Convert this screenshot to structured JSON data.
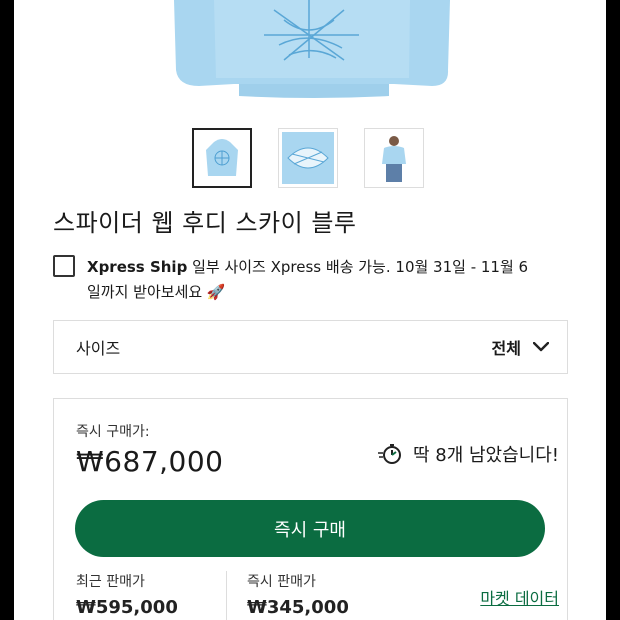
{
  "product": {
    "title": "스파이더 웹 후디 스카이 블루"
  },
  "xpress": {
    "brand": "Xpress Ship",
    "message_line1": "일부 사이즈 Xpress 배송 가능. 10월 31일 - 11월 6",
    "message_line2": "일까지 받아보세요 🚀"
  },
  "size_selector": {
    "label": "사이즈",
    "value": "전체"
  },
  "buy": {
    "label": "즉시 구매가:",
    "price": "₩687,000",
    "stock_text": "딱 8개 남았습니다!",
    "button_label": "즉시 구매",
    "recent_sale_label": "최근 판매가",
    "recent_sale_value": "₩595,000",
    "instant_sell_label": "즉시 판매가",
    "instant_sell_value": "₩345,000",
    "market_data_link": "마켓 데이터"
  },
  "colors": {
    "accent": "#0b6c41",
    "hoodie": "#a9d6f0"
  },
  "icons": {
    "checkbox": "checkbox-empty-icon",
    "chevron": "chevron-down-icon",
    "stopwatch": "stopwatch-icon"
  }
}
